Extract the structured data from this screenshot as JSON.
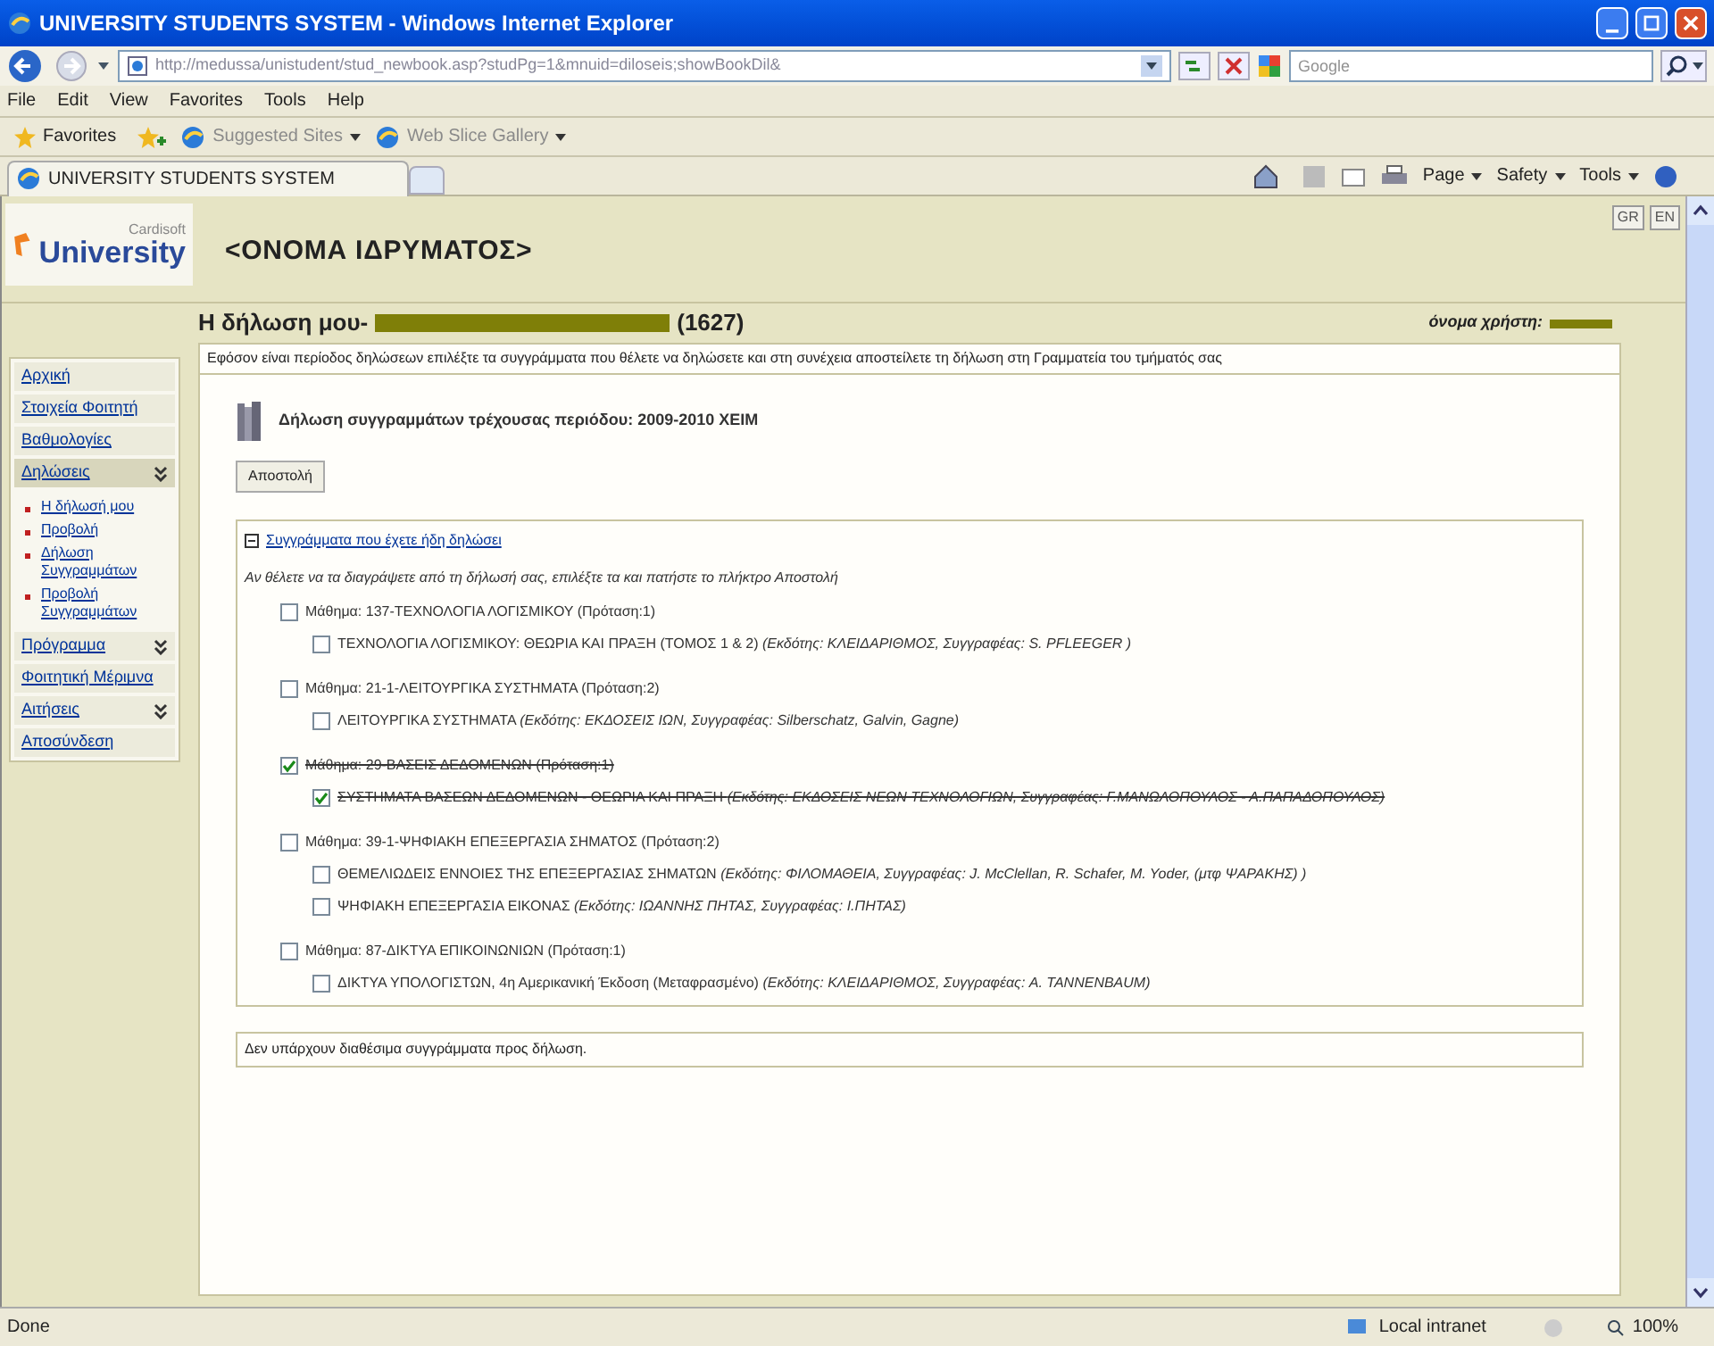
{
  "window": {
    "title": "UNIVERSITY STUDENTS SYSTEM - Windows Internet Explorer"
  },
  "address_bar": {
    "url": "http://medussa/unistudent/stud_newbook.asp?studPg=1&mnuid=diloseis;showBookDil&",
    "search_placeholder": "Google"
  },
  "menu": [
    "File",
    "Edit",
    "View",
    "Favorites",
    "Tools",
    "Help"
  ],
  "favorites_bar": {
    "label": "Favorites",
    "links": [
      "Suggested Sites",
      "Web Slice Gallery"
    ]
  },
  "tab": {
    "title": "UNIVERSITY STUDENTS SYSTEM"
  },
  "command_bar": [
    "Page",
    "Safety",
    "Tools"
  ],
  "page": {
    "logo": {
      "brand": "Cardisoft",
      "name": "University"
    },
    "institution": "<ΟΝΟΜΑ ΙΔΡΥΜΑΤΟΣ>",
    "languages": [
      "GR",
      "EN"
    ],
    "heading": "Η δήλωση μου-",
    "student_id": "(1627)",
    "user_label": "όνομα χρήστη:",
    "info": "Εφόσον είναι περίοδος δηλώσεων επιλέξτε τα συγγράμματα που θέλετε να δηλώσετε και στη συνέχεια αποστείλετε τη δήλωση στη Γραμματεία του τμήματός σας",
    "period_title": "Δήλωση συγγραμμάτων τρέχουσας περιόδου: 2009-2010 ΧΕΙΜ",
    "send_button": "Αποστολή",
    "declared": {
      "title": "Συγγράμματα που έχετε ήδη δηλώσει",
      "expanded": true,
      "hint": "Αν θέλετε να τα διαγράψετε από τη δήλωσή σας, επιλέξτε τα και πατήστε το πλήκτρο Αποστολή",
      "courses": [
        {
          "label": "Μάθημα: 137-ΤΕΧΝΟΛΟΓΙΑ ΛΟΓΙΣΜΙΚΟΥ (Πρόταση:1)",
          "checked": false,
          "books": [
            {
              "label": "ΤΕΧΝΟΛΟΓΙΑ ΛΟΓΙΣΜΙΚΟΥ: ΘΕΩΡΙΑ ΚΑΙ ΠΡΑΞΗ (ΤΟΜΟΣ 1 & 2) *(Εκδότης: ΚΛΕΙΔΑΡΙΘΜΟΣ, Συγγραφέας: S. PFLEEGER )*",
              "checked": false
            }
          ]
        },
        {
          "label": "Μάθημα: 21-1-ΛΕΙΤΟΥΡΓΙΚΑ ΣΥΣΤΗΜΑΤΑ (Πρόταση:2)",
          "checked": false,
          "books": [
            {
              "label": "ΛΕΙΤΟΥΡΓΙΚΑ ΣΥΣΤΗΜΑΤΑ *(Εκδότης: ΕΚΔΟΣΕΙΣ ΙΩΝ, Συγγραφέας: Silberschatz, Galvin, Gagne)*",
              "checked": false
            }
          ]
        },
        {
          "label": "Μάθημα: 29-ΒΑΣΕΙΣ ΔΕΔΟΜΕΝΩΝ (Πρόταση:1)",
          "checked": true,
          "books": [
            {
              "label": "ΣΥΣΤΗΜΑΤΑ ΒΑΣΕΩΝ ΔΕΔΟΜΕΝΩΝ - ΘΕΩΡΙΑ ΚΑΙ ΠΡΑΞΗ *(Εκδότης: ΕΚΔΟΣΕΙΣ ΝΕΩΝ ΤΕΧΝΟΛΟΓΙΩΝ, Συγγραφέας: Γ.ΜΑΝΩΛΟΠΟΥΛΟΣ - Α.ΠΑΠΑΔΟΠΟΥΛΟΣ)*",
              "checked": true
            }
          ]
        },
        {
          "label": "Μάθημα: 39-1-ΨΗΦΙΑΚΗ ΕΠΕΞΕΡΓΑΣΙΑ ΣΗΜΑΤΟΣ (Πρόταση:2)",
          "checked": false,
          "books": [
            {
              "label": "ΘΕΜΕΛΙΩΔΕΙΣ ΕΝΝΟΙΕΣ ΤΗΣ ΕΠΕΞΕΡΓΑΣΙΑΣ ΣΗΜΑΤΩΝ *(Εκδότης: ΦΙΛΟΜΑΘΕΙΑ, Συγγραφέας: J. McClellan, R. Schafer, M. Yoder, (μτφ ΨΑΡΑΚΗΣ) )*",
              "checked": false
            },
            {
              "label": "ΨΗΦΙΑΚΗ ΕΠΕΞΕΡΓΑΣΙΑ ΕΙΚΟΝΑΣ *(Εκδότης: ΙΩΑΝΝΗΣ ΠΗΤΑΣ, Συγγραφέας: Ι.ΠΗΤΑΣ)*",
              "checked": false
            }
          ]
        },
        {
          "label": "Μάθημα: 87-ΔΙΚΤΥΑ ΕΠΙΚΟΙΝΩΝΙΩΝ (Πρόταση:1)",
          "checked": false,
          "books": [
            {
              "label": "ΔΙΚΤΥΑ ΥΠΟΛΟΓΙΣΤΩΝ, 4η Αμερικανική Έκδοση (Μεταφρασμένο) *(Εκδότης: ΚΛΕΙΔΑΡΙΘΜΟΣ, Συγγραφέας: A. TANNENBAUM)*",
              "checked": false
            }
          ]
        }
      ]
    },
    "available_note": "Δεν υπάρχουν διαθέσιμα συγγράμματα προς δήλωση."
  },
  "sidebar": {
    "items": [
      {
        "label": "Αρχική",
        "kind": "link"
      },
      {
        "label": "Στοιχεία Φοιτητή",
        "kind": "link"
      },
      {
        "label": "Βαθμολογίες",
        "kind": "link"
      },
      {
        "label": "Δηλώσεις",
        "kind": "group",
        "expanded": true,
        "children": [
          {
            "label": "Η δήλωσή μου"
          },
          {
            "label": "Προβολή"
          },
          {
            "label": "Δήλωση Συγγραμμάτων"
          },
          {
            "label": "Προβολή Συγγραμμάτων"
          }
        ]
      },
      {
        "label": "Πρόγραμμα",
        "kind": "group",
        "expanded": false
      },
      {
        "label": "Φοιτητική Μέριμνα",
        "kind": "link"
      },
      {
        "label": "Αιτήσεις",
        "kind": "group",
        "expanded": false
      },
      {
        "label": "Αποσύνδεση",
        "kind": "link"
      }
    ]
  },
  "status_bar": {
    "status": "Done",
    "zone": "Local intranet",
    "zoom": "100%"
  }
}
